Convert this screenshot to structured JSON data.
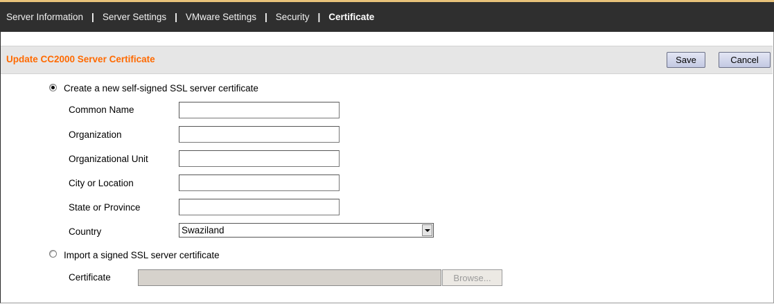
{
  "nav": {
    "items": [
      {
        "label": "Server Information"
      },
      {
        "label": "Server Settings"
      },
      {
        "label": "VMware Settings"
      },
      {
        "label": "Security"
      },
      {
        "label": "Certificate"
      }
    ],
    "separator": "|"
  },
  "header": {
    "title": "Update CC2000 Server Certificate",
    "save_label": "Save",
    "cancel_label": "Cancel"
  },
  "form": {
    "option_create": {
      "label": "Create a new self-signed SSL server certificate",
      "selected": true
    },
    "fields": {
      "common_name": {
        "label": "Common Name",
        "value": ""
      },
      "organization": {
        "label": "Organization",
        "value": ""
      },
      "org_unit": {
        "label": "Organizational Unit",
        "value": ""
      },
      "city": {
        "label": "City or Location",
        "value": ""
      },
      "state": {
        "label": "State or Province",
        "value": ""
      },
      "country": {
        "label": "Country",
        "value": "Swaziland"
      }
    },
    "option_import": {
      "label": "Import a signed SSL server certificate",
      "selected": false
    },
    "certificate": {
      "label": "Certificate",
      "value": "",
      "browse_label": "Browse..."
    }
  },
  "colors": {
    "title": "#ff6a00",
    "topnav_bg": "#2f2f2f",
    "titlebar_bg": "#e6e6e6"
  }
}
